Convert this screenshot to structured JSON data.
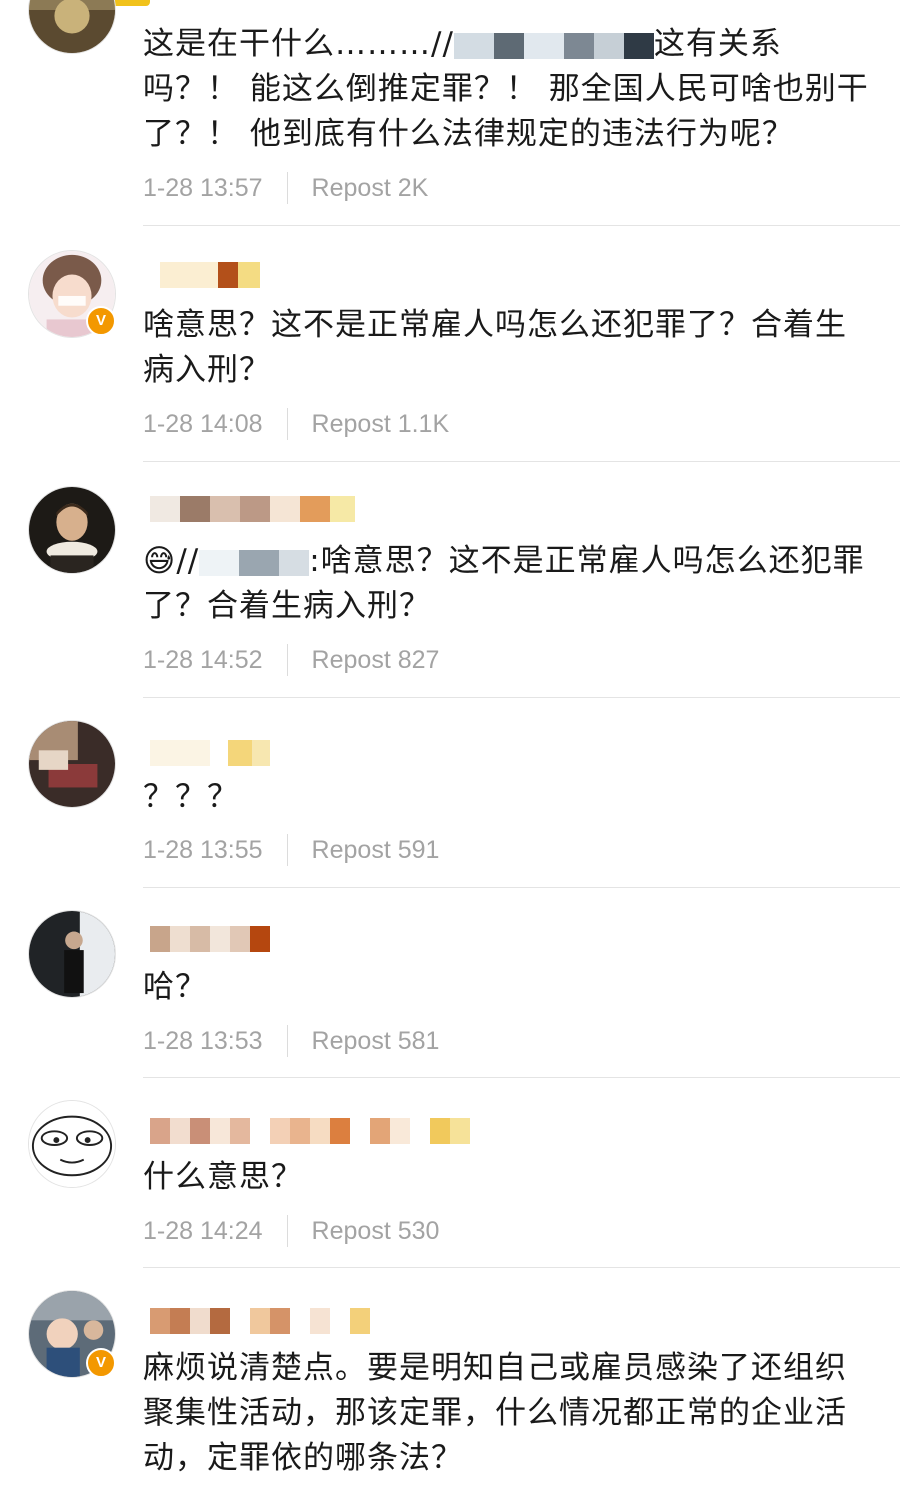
{
  "comments": [
    {
      "text_before": "这是在干什么………//",
      "text_after": "这有关系吗？！ 能这么倒推定罪？！ 那全国人民可啥也别干了？！ 他到底有什么法律规定的违法行为呢？",
      "time": "1-28 13:57",
      "repost": "Repost 2K",
      "avatar_icon": "avatar-photo-icon"
    },
    {
      "text": "啥意思？这不是正常雇人吗怎么还犯罪了？合着生病入刑？",
      "time": "1-28 14:08",
      "repost": "Repost 1.1K",
      "verified": true,
      "avatar_icon": "avatar-girl-icon"
    },
    {
      "emoji": "😅",
      "text_before": "//",
      "text_after": ":啥意思？这不是正常雇人吗怎么还犯罪了？合着生病入刑？",
      "time": "1-28 14:52",
      "repost": "Repost 827",
      "avatar_icon": "avatar-portrait-icon"
    },
    {
      "text": "？？？",
      "time": "1-28 13:55",
      "repost": "Repost 591",
      "avatar_icon": "avatar-photo-icon"
    },
    {
      "text": "哈？",
      "time": "1-28 13:53",
      "repost": "Repost 581",
      "avatar_icon": "avatar-man-icon"
    },
    {
      "text": "什么意思？",
      "time": "1-28 14:24",
      "repost": "Repost 530",
      "avatar_icon": "avatar-meme-face-icon"
    },
    {
      "text": "麻烦说清楚点。要是明知自己或雇员感染了还组织聚集性活动，那该定罪，什么情况都正常的企业活动，定罪依的哪条法？",
      "verified": true,
      "avatar_icon": "avatar-baby-icon"
    }
  ],
  "verified_badge": "V",
  "colors": {
    "verified": "#f39800",
    "meta_text": "#a3a3a3",
    "body_text": "#1a1a1a"
  }
}
